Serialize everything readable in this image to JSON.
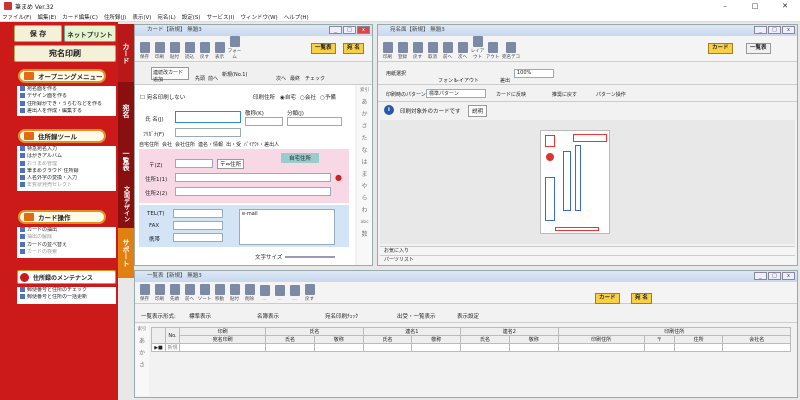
{
  "app": {
    "title": "筆まめ Ver.32",
    "window_controls": [
      "–",
      "□",
      "✕"
    ]
  },
  "menu": [
    "ファイル(F)",
    "編集(E)",
    "カード編集(C)",
    "住所録(J)",
    "表示(V)",
    "宛名(L)",
    "設定(S)",
    "サービス(I)",
    "ウィンドウ(W)",
    "ヘルプ(H)"
  ],
  "left": {
    "save": "保 存",
    "netprint": "ネットプリント",
    "atena_print": "宛名印刷",
    "opening": "オープニングメニュー",
    "opening_items": [
      "宛名面を作る",
      "デザイン面を作る",
      "住所録ができ・うらむなどを作る",
      "差出人を作成・編集する"
    ],
    "addr_tool": "住所録ツール",
    "addr_items": [
      "特急宛名入力",
      "はがきアルバム",
      "おうまめ管理",
      "筆まめクラウド 住所録",
      "人名外字の変換・入力",
      "年賀状発売セレクト"
    ],
    "card_ops": "カード操作",
    "card_items": [
      "カードの抽出",
      "抽出の解除",
      "カードの並べ替え",
      "カードの検索"
    ],
    "maint": "住所録のメンテナンス",
    "maint_items": [
      "郵便番号と住所のチェック",
      "郵便番号と住所の一括更新"
    ]
  },
  "vtabs": {
    "card": "カード",
    "atena": "宛名",
    "ichiran": "一覧表",
    "design": "文面デザイン",
    "support": "サポート"
  },
  "card_win": {
    "title": "カード【新規】 無題3",
    "tools": [
      "保存",
      "印刷",
      "貼付",
      "読込",
      "戻す",
      "表示",
      "フォーム"
    ],
    "list_btn": "一覧表",
    "atena_btn": "宛 名",
    "nav": [
      "連続改カード追加",
      "先頭",
      "前へ",
      "新規(No.1)",
      "次へ",
      "最終",
      "チェック"
    ],
    "no_print": "宛名印刷しない",
    "print_addr": "印刷住所",
    "radio": [
      "自宅",
      "会社",
      "予備"
    ],
    "name_label": "氏 名(J)",
    "title_label": "敬称(K)",
    "bunrui": "分類(J)",
    "furigana": "ﾌﾘｶﾞﾅ(F)",
    "tabs": [
      "自宅住所",
      "会社",
      "会社住所",
      "連名・情報",
      "出・受",
      "ﾊﾟｲｱｳﾄ・差出人"
    ],
    "zip": "〒(Z)",
    "zip_btn": "〒⇔住所",
    "jitaku": "自宅住所",
    "addr1": "住所1(1)",
    "addr2": "住所2(2)",
    "tel": "TEL(T)",
    "fax": "FAX",
    "mobile": "携帯",
    "email": "e-mail",
    "fontsize": "文字サイズ",
    "kana": [
      "索引",
      "あ",
      "か",
      "さ",
      "た",
      "な",
      "は",
      "ま",
      "や",
      "ら",
      "わ",
      "abc",
      "数"
    ]
  },
  "atena_win": {
    "title": "宛名面【新規】 無題3",
    "tools": [
      "印刷",
      "登録",
      "戻す",
      "取消",
      "前へ",
      "次へ",
      "レイアウト",
      "アウト",
      "宛名デコ"
    ],
    "card_btn": "カード",
    "list_btn": "一覧表",
    "paper": "用紙選択",
    "font": "フォント",
    "layout": "レイアウト",
    "ondoku": "差出",
    "zoom": "100%",
    "pattern_label": "印刷時のパターン",
    "pattern": "標準パターン",
    "reflect": "カードに反映",
    "revert": "推奨に戻す",
    "pattern_op": "パターン操作",
    "notice": "印刷対象外のカードです",
    "explain": "説明",
    "favorites": "お気に入り",
    "parts": "パーツリスト"
  },
  "list_win": {
    "title": "一覧表【新規】 無題3",
    "tools": [
      "保存",
      "印刷",
      "先頭",
      "前へ",
      "ソート",
      "移動",
      "貼付",
      "削除",
      "…",
      "…",
      "…",
      "戻す"
    ],
    "card_btn": "カード",
    "atena_btn": "宛 名",
    "format_label": "一覧表示形式:",
    "std": "標準表示",
    "name_view": "名簿表示",
    "atena_check": "宛名印刷ﾁｪｯｸ",
    "out_in": "出受・一覧表示",
    "display_set": "表示設定",
    "group_headers": [
      "No.",
      "印刷",
      "氏名",
      "連名1",
      "連名2",
      "印刷住所"
    ],
    "headers": [
      "宛名印刷",
      "氏名",
      "敬称",
      "氏名",
      "敬称",
      "氏名",
      "敬称",
      "印刷住所",
      "〒",
      "住所",
      "会社名"
    ],
    "row": "新規",
    "kana": [
      "索引",
      "あ",
      "か",
      "さ"
    ]
  },
  "colors": {
    "accent_red": "#cc1a1a",
    "yellow": "#f7d046",
    "orange": "#e09020"
  }
}
